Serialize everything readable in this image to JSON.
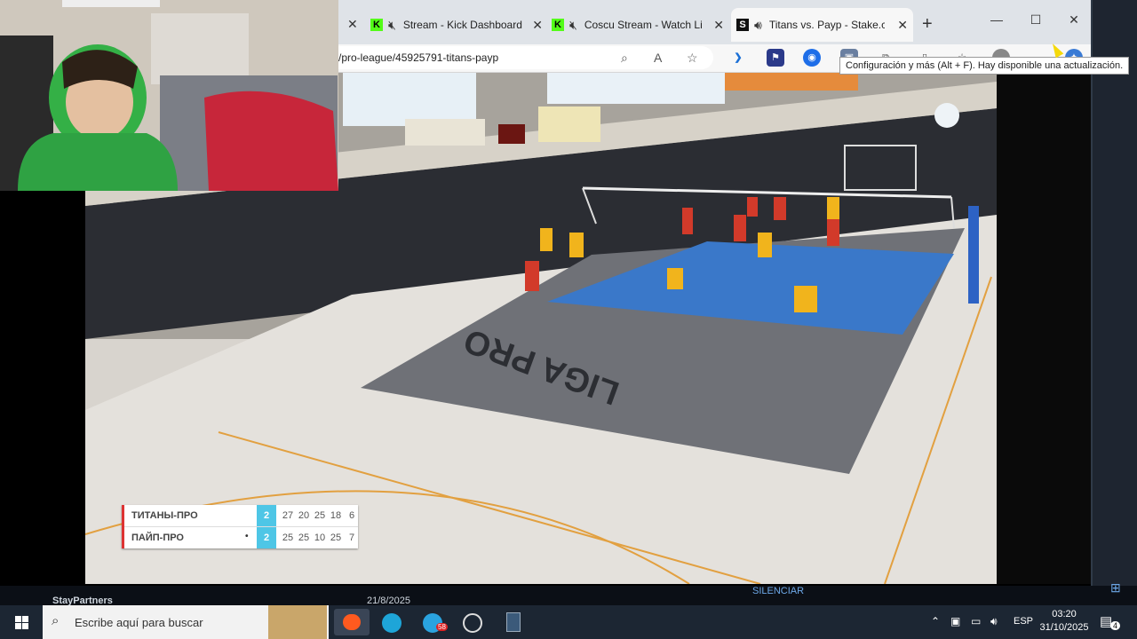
{
  "browser": {
    "tabs": [
      {
        "label": "Stream - Kick Dashboard",
        "icon": "kick-logo-icon",
        "muted": true
      },
      {
        "label": "Coscu Stream - Watch Li",
        "icon": "kick-logo-icon",
        "muted": true
      },
      {
        "label": "Titans vs. Payp - Stake.co",
        "icon": "stake-logo-icon",
        "muted": false,
        "active": true
      }
    ],
    "url": "/pro-league/45925791-titans-payp",
    "tooltip": "Configuración y más (Alt + F). Hay disponible una actualización.",
    "kick_glyph": "K",
    "stake_glyph": "S"
  },
  "stream": {
    "court_text": "LIGA PRO",
    "scoreboard": {
      "rows": [
        {
          "team": "ТИТАНЫ-ПРО",
          "serving": false,
          "sets": "2",
          "points": [
            "27",
            "20",
            "25",
            "18",
            "6"
          ]
        },
        {
          "team": "ПАЙП-ПРО",
          "serving": true,
          "sets": "2",
          "points": [
            "25",
            "25",
            "10",
            "25",
            "7"
          ]
        }
      ]
    }
  },
  "overlay": {
    "left_label": "StayPartners",
    "date_label": "21/8/2025",
    "center_label": "SILENCIAR"
  },
  "taskbar": {
    "search_placeholder": "Escribe aquí para buscar",
    "language": "ESP",
    "time": "03:20",
    "date": "31/10/2025",
    "notification_count": "4",
    "telegram_badge": "58"
  },
  "colors": {
    "accent_cyan": "#4ec6e6",
    "kick_green": "#53fc18",
    "team_red_border": "#dd3333"
  }
}
